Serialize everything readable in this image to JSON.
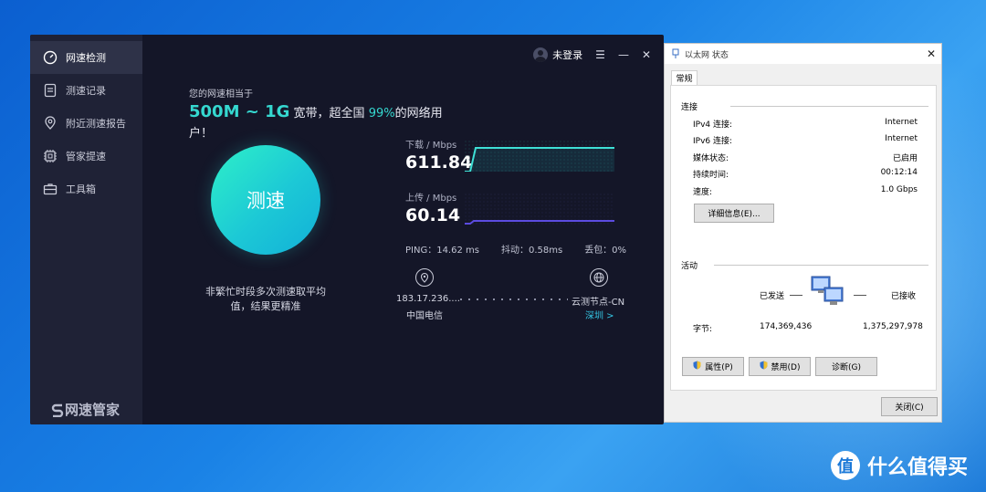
{
  "speed_app": {
    "sidebar": [
      {
        "label": "网速检测",
        "icon": "speedometer-icon",
        "active": true
      },
      {
        "label": "测速记录",
        "icon": "record-list-icon",
        "active": false
      },
      {
        "label": "附近测速报告",
        "icon": "location-pin-icon",
        "active": false
      },
      {
        "label": "管家提速",
        "icon": "chip-icon",
        "active": false
      },
      {
        "label": "工具箱",
        "icon": "toolbox-icon",
        "active": false
      }
    ],
    "brand": "网速管家",
    "user": {
      "login_label": "未登录"
    },
    "window_controls": {
      "menu": "☰",
      "minimize": "—",
      "close": "✕"
    },
    "result": {
      "intro": "您的网速相当于",
      "speed_range": "500M ~ 1G",
      "suffix1": "宽带，超全国",
      "percent": "99%",
      "suffix2": "的网络用户！"
    },
    "start_button": "测速",
    "tip": "非繁忙时段多次测速取平均值，结果更精准",
    "download": {
      "label": "下载 / Mbps",
      "value": "611.84"
    },
    "upload": {
      "label": "上传 / Mbps",
      "value": "60.14"
    },
    "stats": {
      "ping": "PING：14.62 ms",
      "jitter": "抖动：0.58ms",
      "loss": "丢包：0%"
    },
    "client": {
      "ip": "183.17.236....",
      "isp": "中国电信"
    },
    "server": {
      "name": "云测节点-CN",
      "city_link": "深圳 >"
    }
  },
  "dialog": {
    "title": "以太网 状态",
    "tab": "常规",
    "connection": {
      "section": "连接",
      "rows": [
        {
          "label": "IPv4 连接:",
          "value": "Internet"
        },
        {
          "label": "IPv6 连接:",
          "value": "Internet"
        },
        {
          "label": "媒体状态:",
          "value": "已启用"
        },
        {
          "label": "持续时间:",
          "value": "00:12:14"
        },
        {
          "label": "速度:",
          "value": "1.0 Gbps"
        }
      ],
      "details_button": "详细信息(E)..."
    },
    "activity": {
      "section": "活动",
      "sent_label": "已发送",
      "received_label": "已接收",
      "bytes_label": "字节:",
      "sent_bytes": "174,369,436",
      "received_bytes": "1,375,297,978"
    },
    "buttons": {
      "properties": "属性(P)",
      "disable": "禁用(D)",
      "diagnose": "诊断(G)",
      "close": "关闭(C)"
    }
  },
  "watermark": {
    "icon_char": "值",
    "text": "什么值得买"
  }
}
